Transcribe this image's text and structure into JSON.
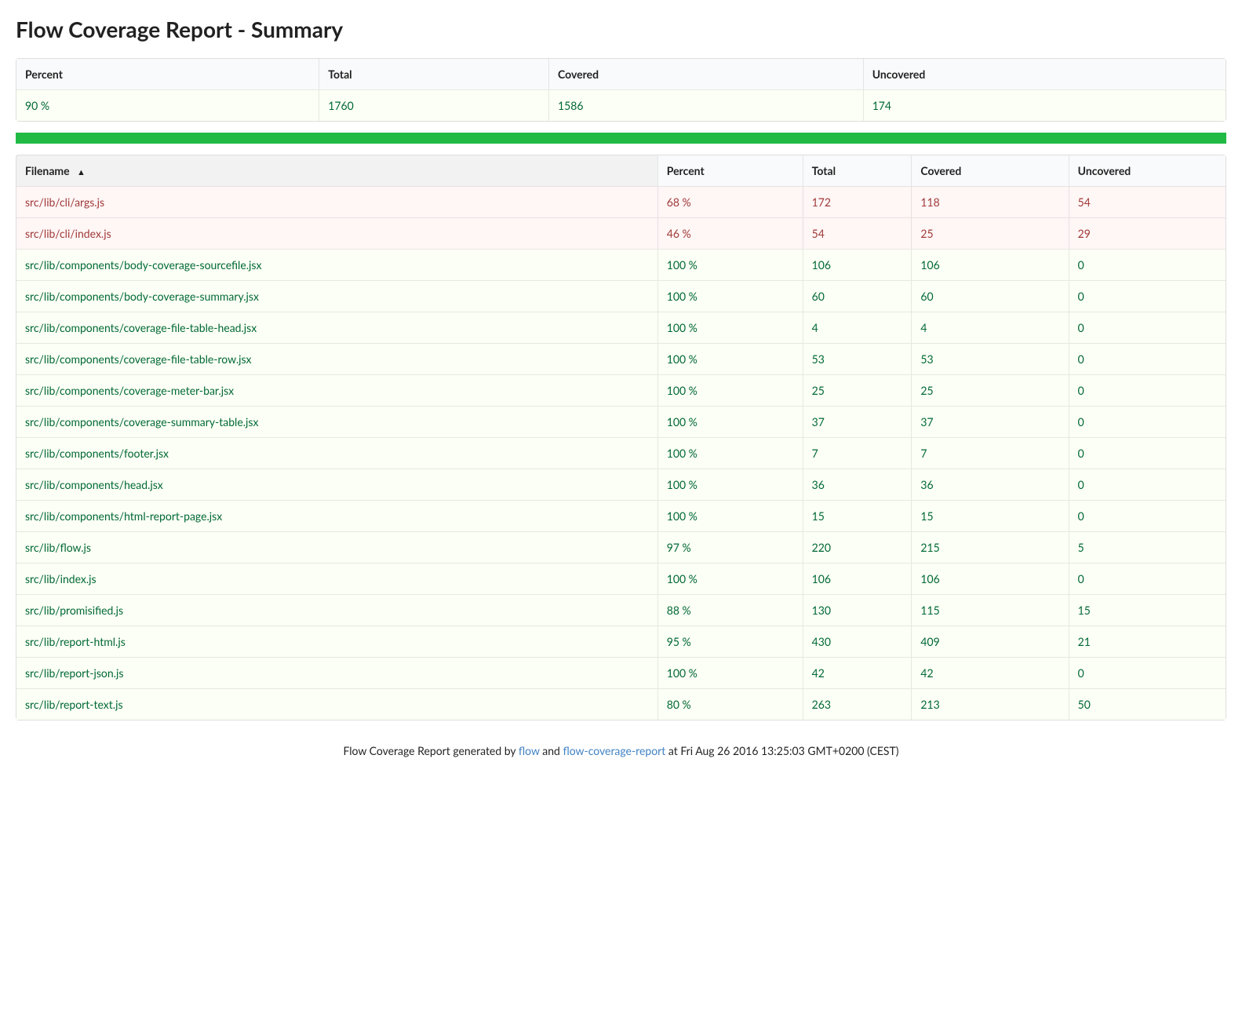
{
  "title": "Flow Coverage Report - Summary",
  "summary": {
    "headers": {
      "percent": "Percent",
      "total": "Total",
      "covered": "Covered",
      "uncovered": "Uncovered"
    },
    "values": {
      "percent": "90 %",
      "total": "1760",
      "covered": "1586",
      "uncovered": "174"
    }
  },
  "filesTable": {
    "headers": {
      "filename": "Filename",
      "percent": "Percent",
      "total": "Total",
      "covered": "Covered",
      "uncovered": "Uncovered"
    },
    "rows": [
      {
        "filename": "src/lib/cli/args.js",
        "percent": "68 %",
        "total": "172",
        "covered": "118",
        "uncovered": "54",
        "status": "red"
      },
      {
        "filename": "src/lib/cli/index.js",
        "percent": "46 %",
        "total": "54",
        "covered": "25",
        "uncovered": "29",
        "status": "red"
      },
      {
        "filename": "src/lib/components/body-coverage-sourcefile.jsx",
        "percent": "100 %",
        "total": "106",
        "covered": "106",
        "uncovered": "0",
        "status": "green"
      },
      {
        "filename": "src/lib/components/body-coverage-summary.jsx",
        "percent": "100 %",
        "total": "60",
        "covered": "60",
        "uncovered": "0",
        "status": "green"
      },
      {
        "filename": "src/lib/components/coverage-file-table-head.jsx",
        "percent": "100 %",
        "total": "4",
        "covered": "4",
        "uncovered": "0",
        "status": "green"
      },
      {
        "filename": "src/lib/components/coverage-file-table-row.jsx",
        "percent": "100 %",
        "total": "53",
        "covered": "53",
        "uncovered": "0",
        "status": "green"
      },
      {
        "filename": "src/lib/components/coverage-meter-bar.jsx",
        "percent": "100 %",
        "total": "25",
        "covered": "25",
        "uncovered": "0",
        "status": "green"
      },
      {
        "filename": "src/lib/components/coverage-summary-table.jsx",
        "percent": "100 %",
        "total": "37",
        "covered": "37",
        "uncovered": "0",
        "status": "green"
      },
      {
        "filename": "src/lib/components/footer.jsx",
        "percent": "100 %",
        "total": "7",
        "covered": "7",
        "uncovered": "0",
        "status": "green"
      },
      {
        "filename": "src/lib/components/head.jsx",
        "percent": "100 %",
        "total": "36",
        "covered": "36",
        "uncovered": "0",
        "status": "green"
      },
      {
        "filename": "src/lib/components/html-report-page.jsx",
        "percent": "100 %",
        "total": "15",
        "covered": "15",
        "uncovered": "0",
        "status": "green"
      },
      {
        "filename": "src/lib/flow.js",
        "percent": "97 %",
        "total": "220",
        "covered": "215",
        "uncovered": "5",
        "status": "green"
      },
      {
        "filename": "src/lib/index.js",
        "percent": "100 %",
        "total": "106",
        "covered": "106",
        "uncovered": "0",
        "status": "green"
      },
      {
        "filename": "src/lib/promisified.js",
        "percent": "88 %",
        "total": "130",
        "covered": "115",
        "uncovered": "15",
        "status": "green"
      },
      {
        "filename": "src/lib/report-html.js",
        "percent": "95 %",
        "total": "430",
        "covered": "409",
        "uncovered": "21",
        "status": "green"
      },
      {
        "filename": "src/lib/report-json.js",
        "percent": "100 %",
        "total": "42",
        "covered": "42",
        "uncovered": "0",
        "status": "green"
      },
      {
        "filename": "src/lib/report-text.js",
        "percent": "80 %",
        "total": "263",
        "covered": "213",
        "uncovered": "50",
        "status": "green"
      }
    ]
  },
  "footer": {
    "prefix": "Flow Coverage Report generated by ",
    "link1": "flow",
    "and": " and ",
    "link2": "flow-coverage-report",
    "at": " at ",
    "timestamp": "Fri Aug 26 2016 13:25:03 GMT+0200 (CEST)"
  }
}
